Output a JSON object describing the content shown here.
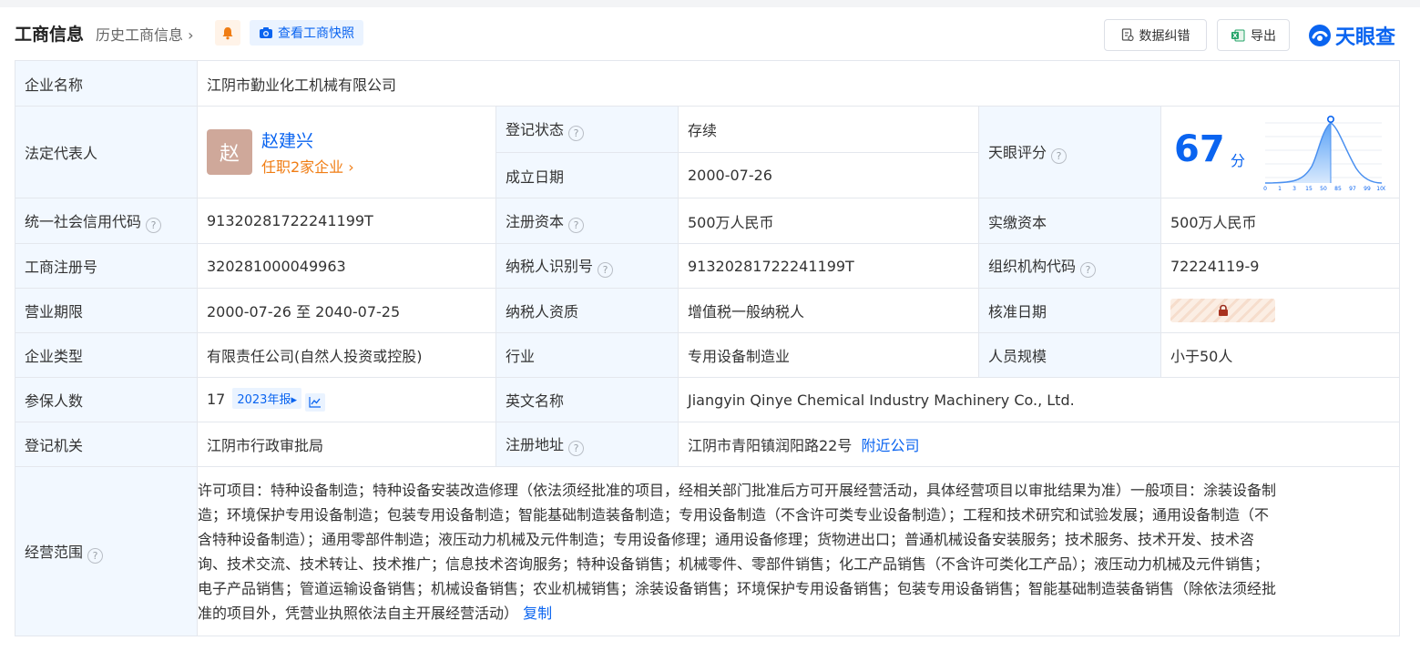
{
  "header": {
    "title": "工商信息",
    "history": "历史工商信息",
    "snapshot": "查看工商快照",
    "error_button": "数据纠错",
    "export_button": "导出",
    "logo_text": "天眼查"
  },
  "rows": {
    "company_name": {
      "label": "企业名称",
      "value": "江阴市勤业化工机械有限公司"
    },
    "legal_rep": {
      "label": "法定代表人",
      "avatar_char": "赵",
      "name": "赵建兴",
      "positions": "任职2家企业"
    },
    "reg_status": {
      "label": "登记状态",
      "value": "存续"
    },
    "established": {
      "label": "成立日期",
      "value": "2000-07-26"
    },
    "score": {
      "label": "天眼评分",
      "value": "67",
      "unit": "分",
      "axis": [
        "0",
        "1",
        "3",
        "15",
        "50",
        "85",
        "97",
        "99",
        "100"
      ]
    },
    "credit_code": {
      "label": "统一社会信用代码",
      "value": "91320281722241199T"
    },
    "reg_capital": {
      "label": "注册资本",
      "value": "500万人民币"
    },
    "paid_capital": {
      "label": "实缴资本",
      "value": "500万人民币"
    },
    "reg_number": {
      "label": "工商注册号",
      "value": "320281000049963"
    },
    "taxpayer_id": {
      "label": "纳税人识别号",
      "value": "91320281722241199T"
    },
    "org_code": {
      "label": "组织机构代码",
      "value": "72224119-9"
    },
    "term": {
      "label": "营业期限",
      "value": "2000-07-26 至 2040-07-25"
    },
    "taxpayer_type": {
      "label": "纳税人资质",
      "value": "增值税一般纳税人"
    },
    "approval_date": {
      "label": "核准日期"
    },
    "company_type": {
      "label": "企业类型",
      "value": "有限责任公司(自然人投资或控股)"
    },
    "industry": {
      "label": "行业",
      "value": "专用设备制造业"
    },
    "staff_size": {
      "label": "人员规模",
      "value": "小于50人"
    },
    "insured": {
      "label": "参保人数",
      "value": "17",
      "report": "2023年报"
    },
    "english_name": {
      "label": "英文名称",
      "value": "Jiangyin Qinye Chemical Industry Machinery Co., Ltd."
    },
    "authority": {
      "label": "登记机关",
      "value": "江阴市行政审批局"
    },
    "address": {
      "label": "注册地址",
      "value": "江阴市青阳镇润阳路22号",
      "nearby": "附近公司"
    },
    "scope": {
      "label": "经营范围",
      "lines": [
        "许可项目：特种设备制造；特种设备安装改造修理（依法须经批准的项目，经相关部门批准后方可开展经营活动，具体经营项目以审批结果为准）一般项目：涂装设备制",
        "造；环境保护专用设备制造；包装专用设备制造；智能基础制造装备制造；专用设备制造（不含许可类专业设备制造）；工程和技术研究和试验发展；通用设备制造（不",
        "含特种设备制造）；通用零部件制造；液压动力机械及元件制造；专用设备修理；通用设备修理；货物进出口；普通机械设备安装服务；技术服务、技术开发、技术咨",
        "询、技术交流、技术转让、技术推广；信息技术咨询服务；特种设备销售；机械零件、零部件销售；化工产品销售（不含许可类化工产品）；液压动力机械及元件销售；",
        "电子产品销售；管道运输设备销售；机械设备销售；农业机械销售；涂装设备销售；环境保护专用设备销售；包装专用设备销售；智能基础制造装备销售（除依法须经批",
        "准的项目外，凭营业执照依法自主开展经营活动）"
      ],
      "copy": "复制"
    }
  },
  "colors": {
    "accent": "#0a64f0",
    "label_bg": "#f2f8ff",
    "status_green": "#19a15f",
    "orange": "#f07d14"
  }
}
